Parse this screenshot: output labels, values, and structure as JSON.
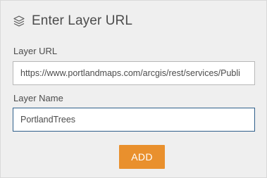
{
  "dialog": {
    "title": "Enter Layer URL",
    "icon": "layers-icon"
  },
  "fields": {
    "url_label": "Layer URL",
    "url_value": "https://www.portlandmaps.com/arcgis/rest/services/Publi",
    "name_label": "Layer Name",
    "name_value": "PortlandTrees"
  },
  "actions": {
    "add_label": "ADD"
  },
  "colors": {
    "panel_bg": "#efefef",
    "accent": "#e9902d",
    "focus_border": "#2e5f8a"
  }
}
